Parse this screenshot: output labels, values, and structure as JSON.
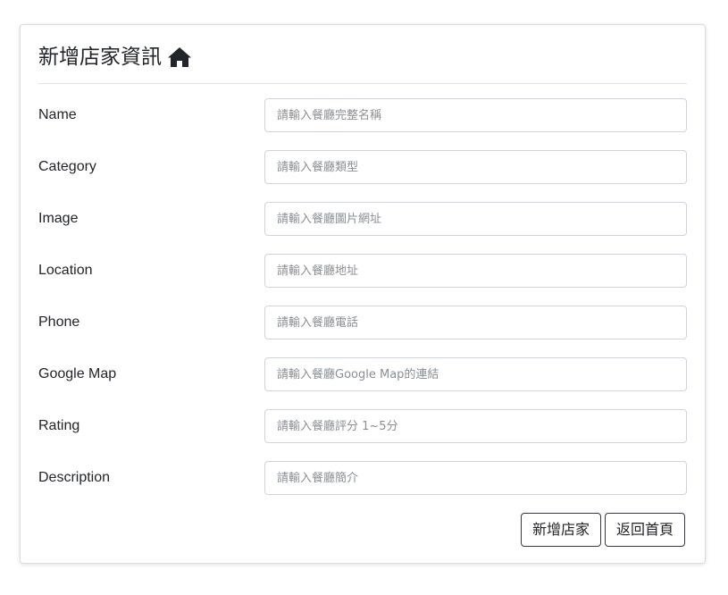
{
  "header": {
    "title": "新增店家資訊",
    "icon": "home-icon"
  },
  "form": {
    "fields": [
      {
        "label": "Name",
        "placeholder": "請輸入餐廳完整名稱",
        "value": ""
      },
      {
        "label": "Category",
        "placeholder": "請輸入餐廳類型",
        "value": ""
      },
      {
        "label": "Image",
        "placeholder": "請輸入餐廳圖片網址",
        "value": ""
      },
      {
        "label": "Location",
        "placeholder": "請輸入餐廳地址",
        "value": ""
      },
      {
        "label": "Phone",
        "placeholder": "請輸入餐廳電話",
        "value": ""
      },
      {
        "label": "Google Map",
        "placeholder": "請輸入餐廳Google Map的連結",
        "value": ""
      },
      {
        "label": "Rating",
        "placeholder": "請輸入餐廳評分 1~5分",
        "value": ""
      },
      {
        "label": "Description",
        "placeholder": "請輸入餐廳簡介",
        "value": ""
      }
    ]
  },
  "actions": {
    "submit_label": "新增店家",
    "back_label": "返回首頁"
  },
  "colors": {
    "text": "#212529",
    "border": "#ced4da",
    "button_border": "#343a40"
  }
}
